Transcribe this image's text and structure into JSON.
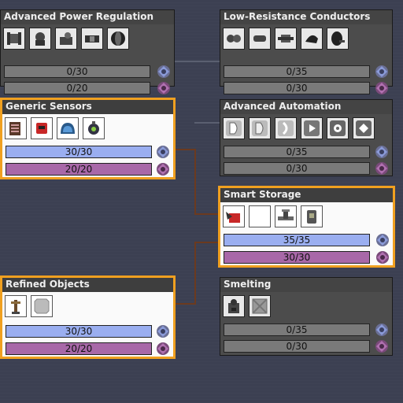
{
  "colors": {
    "background": "#3c4052",
    "highlight": "#f0a020",
    "bar_blue": "#9aaef0",
    "bar_purple": "#a868a8",
    "line": "#6b3a1f"
  },
  "nodes": [
    {
      "title": "Advanced Power Regulation",
      "highlighted": false,
      "icons": [
        "substation-icon",
        "accumulator-icon",
        "power-switch-icon",
        "battery-icon",
        "coil-icon"
      ],
      "bars": [
        {
          "text": "0/30",
          "value": 0,
          "max": 30,
          "pack": "blue-pack-icon"
        },
        {
          "text": "0/20",
          "value": 0,
          "max": 20,
          "pack": "purple-pack-icon"
        }
      ]
    },
    {
      "title": "Low-Resistance Conductors",
      "highlighted": false,
      "icons": [
        "conductor-icon",
        "connector-icon",
        "cable-icon",
        "wire-icon",
        "cable-reel-icon"
      ],
      "bars": [
        {
          "text": "0/35",
          "value": 0,
          "max": 35,
          "pack": "blue-pack-icon"
        },
        {
          "text": "0/30",
          "value": 0,
          "max": 30,
          "pack": "purple-pack-icon"
        }
      ]
    },
    {
      "title": "Generic Sensors",
      "highlighted": true,
      "icons": [
        "sensor-books-icon",
        "mailbox-icon",
        "gauge-icon",
        "lamp-sensor-icon"
      ],
      "bars": [
        {
          "text": "30/30",
          "value": 30,
          "max": 30,
          "pack": "blue-pack-icon"
        },
        {
          "text": "20/20",
          "value": 20,
          "max": 20,
          "pack": "purple-pack-icon"
        }
      ]
    },
    {
      "title": "Advanced Automation",
      "highlighted": false,
      "icons": [
        "inserter-d1-icon",
        "inserter-d2-icon",
        "inserter-d3-icon",
        "inserter-play-icon",
        "inserter-gear-icon",
        "inserter-diamond-icon"
      ],
      "bars": [
        {
          "text": "0/35",
          "value": 0,
          "max": 35,
          "pack": "blue-pack-icon"
        },
        {
          "text": "0/30",
          "value": 0,
          "max": 30,
          "pack": "purple-pack-icon"
        }
      ]
    },
    {
      "title": "Smart Storage",
      "highlighted": true,
      "icons": [
        "arrow-box-icon",
        "empty-slot-icon",
        "valve-icon",
        "tank-icon"
      ],
      "bars": [
        {
          "text": "35/35",
          "value": 35,
          "max": 35,
          "pack": "blue-pack-icon"
        },
        {
          "text": "30/30",
          "value": 30,
          "max": 30,
          "pack": "purple-pack-icon"
        }
      ]
    },
    {
      "title": "Refined Objects",
      "highlighted": true,
      "icons": [
        "pylon-icon",
        "plate-icon"
      ],
      "bars": [
        {
          "text": "30/30",
          "value": 30,
          "max": 30,
          "pack": "blue-pack-icon"
        },
        {
          "text": "20/20",
          "value": 20,
          "max": 20,
          "pack": "purple-pack-icon"
        }
      ]
    },
    {
      "title": "Smelting",
      "highlighted": false,
      "icons": [
        "furnace-icon",
        "crate-icon"
      ],
      "bars": [
        {
          "text": "0/35",
          "value": 0,
          "max": 35,
          "pack": "blue-pack-icon"
        },
        {
          "text": "0/30",
          "value": 0,
          "max": 30,
          "pack": "purple-pack-icon"
        }
      ]
    }
  ]
}
